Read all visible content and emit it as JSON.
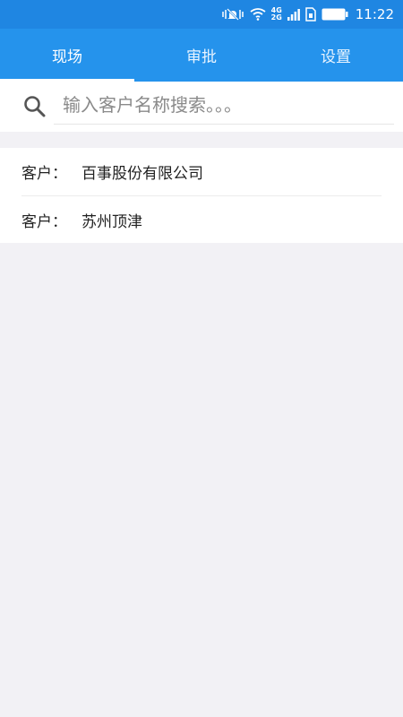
{
  "status_bar": {
    "network_top": "4G",
    "network_bottom": "2G",
    "time": "11:22"
  },
  "tabs": [
    {
      "label": "现场",
      "active": true
    },
    {
      "label": "审批",
      "active": false
    },
    {
      "label": "设置",
      "active": false
    }
  ],
  "search": {
    "placeholder": "输入客户名称搜索。。。",
    "value": ""
  },
  "customers": [
    {
      "label": "客户：",
      "name": "百事股份有限公司"
    },
    {
      "label": "客户：",
      "name": "苏州顶津"
    }
  ],
  "colors": {
    "status_bar_bg": "#1f86e2",
    "tab_bar_bg": "#2593ec",
    "page_bg": "#f2f1f5"
  }
}
